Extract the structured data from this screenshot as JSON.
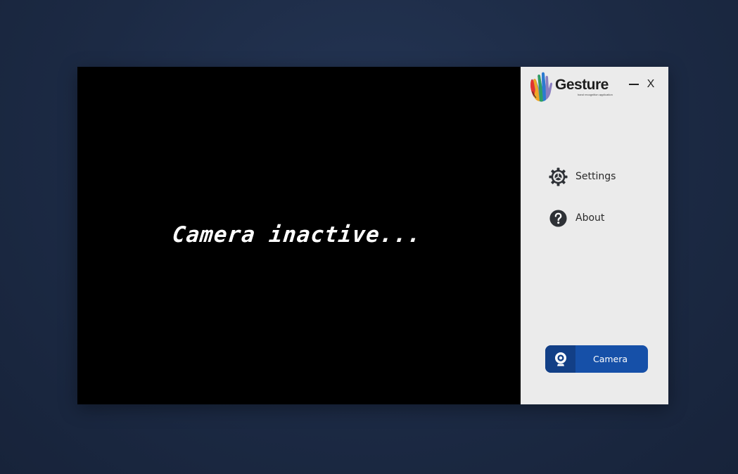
{
  "camera_view": {
    "status_text": "Camera inactive..."
  },
  "sidebar": {
    "brand": {
      "name": "Gesture",
      "tagline": "hand recognition application",
      "logo_icon": "multicolor-hand-logo"
    },
    "window_controls": {
      "minimize_label": "",
      "close_label": "X"
    },
    "menu": [
      {
        "id": "settings",
        "label": "Settings",
        "icon": "gear-icon"
      },
      {
        "id": "about",
        "label": "About",
        "icon": "question-icon"
      }
    ],
    "camera_button": {
      "label": "Camera",
      "icon": "webcam-icon"
    }
  },
  "colors": {
    "desktop_background": "#1c2a44",
    "camera_view_background": "#000000",
    "sidebar_background": "#ebebeb",
    "button_primary": "#1650a8",
    "button_icon_area": "#123f86",
    "icon_dark": "#2e3136"
  }
}
